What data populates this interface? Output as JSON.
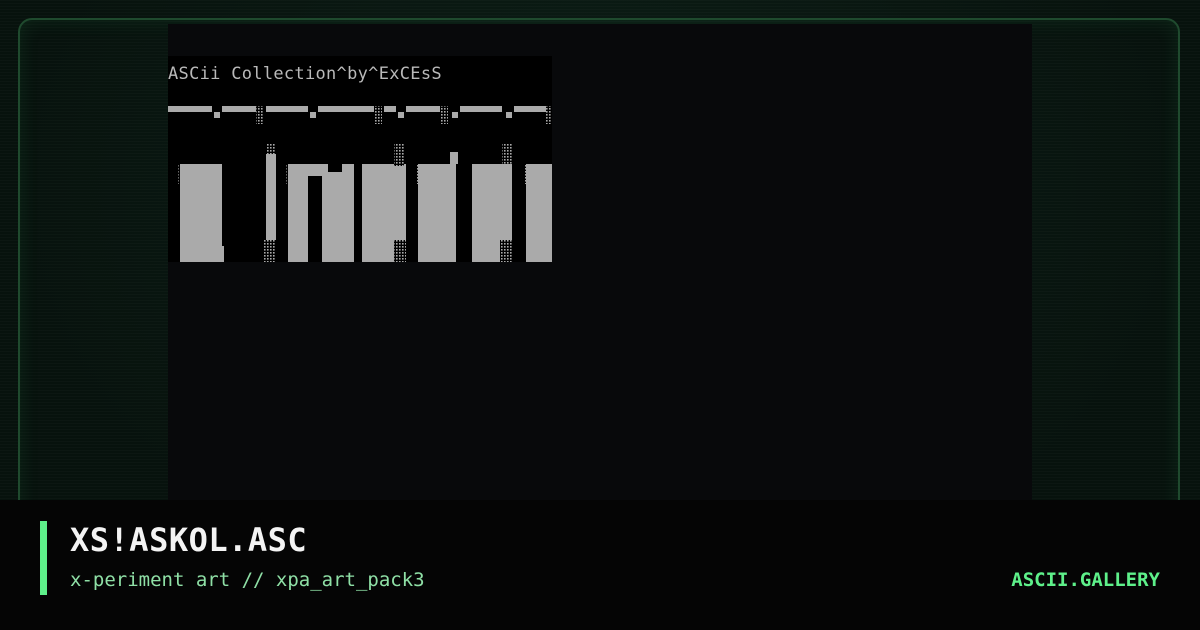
{
  "art": {
    "header_text": "ASCii Collection^by^ExCEsS"
  },
  "footer": {
    "title": "XS!ASKOL.ASC",
    "subtitle": "x-periment art // xpa_art_pack3",
    "brand": "ASCII.GALLERY"
  },
  "colors": {
    "accent": "#5ef08a",
    "subtitle": "#8fe0a6",
    "art_gray": "#aaaaaa"
  }
}
